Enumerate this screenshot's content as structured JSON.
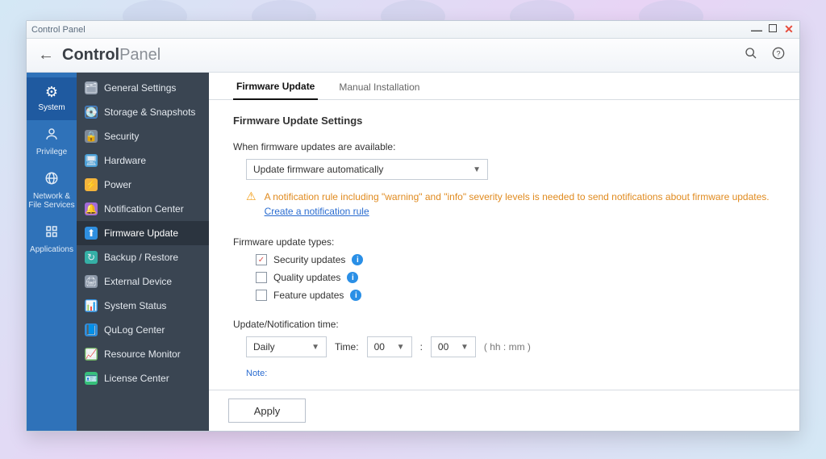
{
  "window": {
    "title": "Control Panel"
  },
  "header": {
    "app_bold": "Control",
    "app_light": "Panel"
  },
  "leftcats": [
    {
      "label": "System",
      "icon": "⚙"
    },
    {
      "label": "Privilege",
      "icon": "👤"
    },
    {
      "label": "Network & File Services",
      "icon": "🌐"
    },
    {
      "label": "Applications",
      "icon": "⊞"
    }
  ],
  "subnav": [
    {
      "label": "General Settings",
      "icon": "🗂",
      "bg": "#9aa5b4"
    },
    {
      "label": "Storage & Snapshots",
      "icon": "💽",
      "bg": "#3b8ae0"
    },
    {
      "label": "Security",
      "icon": "🔒",
      "bg": "#7f8a99"
    },
    {
      "label": "Hardware",
      "icon": "🖥",
      "bg": "#4b9fd6"
    },
    {
      "label": "Power",
      "icon": "⚡",
      "bg": "#f4b43c"
    },
    {
      "label": "Notification Center",
      "icon": "🔔",
      "bg": "#a36bd9"
    },
    {
      "label": "Firmware Update",
      "icon": "⬆",
      "bg": "#2f8fe0"
    },
    {
      "label": "Backup / Restore",
      "icon": "↻",
      "bg": "#35b0a6"
    },
    {
      "label": "External Device",
      "icon": "🖨",
      "bg": "#8c98a8"
    },
    {
      "label": "System Status",
      "icon": "📊",
      "bg": "#2f8fe0"
    },
    {
      "label": "QuLog Center",
      "icon": "📘",
      "bg": "#2f8fe0"
    },
    {
      "label": "Resource Monitor",
      "icon": "📈",
      "bg": "#6fb360"
    },
    {
      "label": "License Center",
      "icon": "🪪",
      "bg": "#36c07a"
    }
  ],
  "tabs": [
    {
      "label": "Firmware Update"
    },
    {
      "label": "Manual Installation"
    }
  ],
  "panel": {
    "title": "Firmware Update Settings",
    "when_label": "When firmware updates are available:",
    "when_select": "Update firmware automatically",
    "warn_text": "A notification rule including \"warning\" and \"info\" severity levels is needed to send notifications about firmware updates. ",
    "warn_link": "Create a notification rule",
    "types_label": "Firmware update types:",
    "types": [
      {
        "label": "Security updates",
        "checked": true
      },
      {
        "label": "Quality updates",
        "checked": false
      },
      {
        "label": "Feature updates",
        "checked": false
      }
    ],
    "time_label": "Update/Notification time:",
    "freq": "Daily",
    "time_word": "Time:",
    "hh": "00",
    "mm": "00",
    "hhmm": "( hh : mm )",
    "note": "Note:",
    "apply": "Apply"
  }
}
